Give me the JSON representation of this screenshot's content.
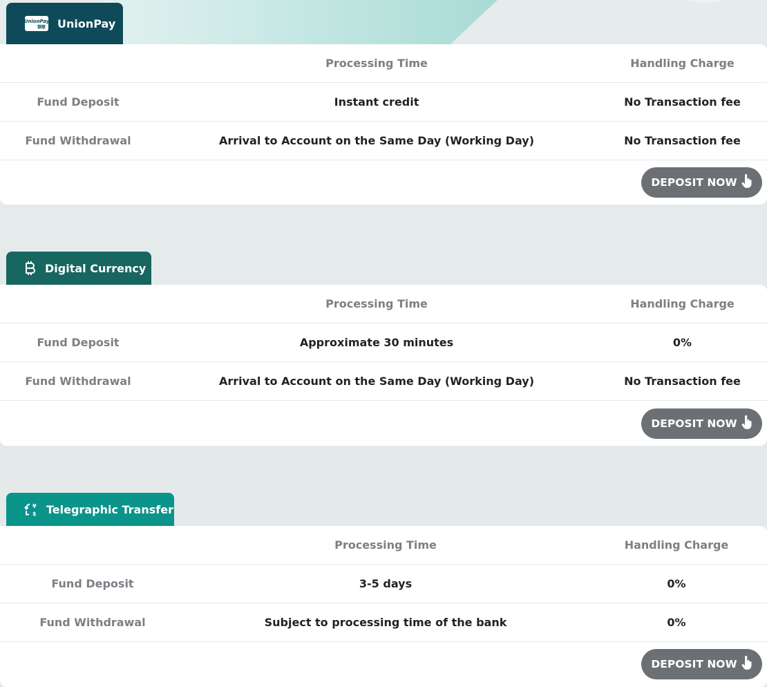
{
  "colors": {
    "unionpay_tab": "#0e4a5a",
    "digital_tab": "#17665f",
    "tt_tab": "#0b948a",
    "button_bg": "#6c7075"
  },
  "sections": [
    {
      "tab_label": "UnionPay",
      "logo_text": "UnionPay",
      "logo_sub": "银联",
      "header": {
        "processing": "Processing Time",
        "handling": "Handling Charge"
      },
      "rows": [
        {
          "label": "Fund Deposit",
          "processing": "Instant credit",
          "handling": "No Transaction fee"
        },
        {
          "label": "Fund Withdrawal",
          "processing": "Arrival to Account on the Same Day (Working Day)",
          "handling": "No Transaction fee"
        }
      ],
      "button": "DEPOSIT NOW"
    },
    {
      "tab_label": "Digital Currency",
      "header": {
        "processing": "Processing Time",
        "handling": "Handling Charge"
      },
      "rows": [
        {
          "label": "Fund Deposit",
          "processing": "Approximate 30 minutes",
          "handling": "0%"
        },
        {
          "label": "Fund Withdrawal",
          "processing": "Arrival to Account on the Same Day (Working Day)",
          "handling": "No Transaction fee"
        }
      ],
      "button": "DEPOSIT NOW"
    },
    {
      "tab_label": "Telegraphic Transfer",
      "header": {
        "processing": "Processing Time",
        "handling": "Handling Charge"
      },
      "rows": [
        {
          "label": "Fund Deposit",
          "processing": "3-5 days",
          "handling": "0%"
        },
        {
          "label": "Fund Withdrawal",
          "processing": "Subject to processing time of the bank",
          "handling": "0%"
        }
      ],
      "button": "DEPOSIT NOW"
    }
  ]
}
